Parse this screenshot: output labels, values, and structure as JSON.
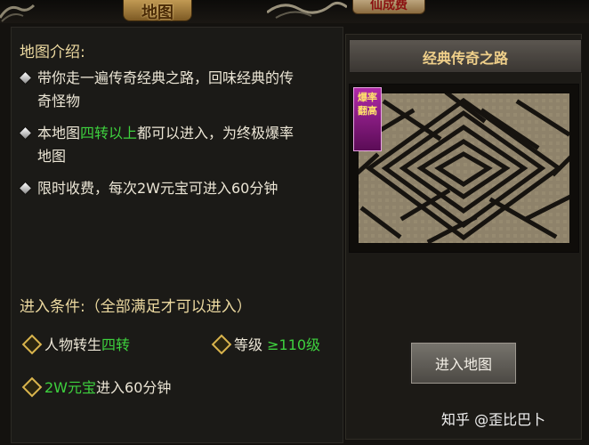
{
  "header": {
    "title": "地图",
    "right_tab_label": "仙成费"
  },
  "intro": {
    "heading": "地图介绍:",
    "bullets": [
      {
        "line1": "带你走一遍传奇经典之路，回味经典的传",
        "line2": "奇怪物"
      },
      {
        "pre": "本地图",
        "highlight": "四转以上",
        "post": "都可以进入，为终极爆率",
        "line2": "地图"
      },
      {
        "line1": "限时收费，每次2W元宝可进入60分钟"
      }
    ]
  },
  "conditions": {
    "heading": "进入条件:（全部满足才可以进入）",
    "items": [
      {
        "label": "人物转生",
        "value": "四转"
      },
      {
        "label": "等级",
        "value": "≥110级"
      },
      {
        "value": "2W元宝",
        "label": "进入60分钟"
      }
    ]
  },
  "map": {
    "name": "经典传奇之路",
    "badge_text": "爆率翻高"
  },
  "actions": {
    "enter_label": "进入地图"
  },
  "watermark": "知乎 @歪比巴卜",
  "colors": {
    "highlight": "#3ed13e",
    "heading": "#ecd9a0",
    "panel": "#1b1a17",
    "button": "#5f5c56"
  }
}
